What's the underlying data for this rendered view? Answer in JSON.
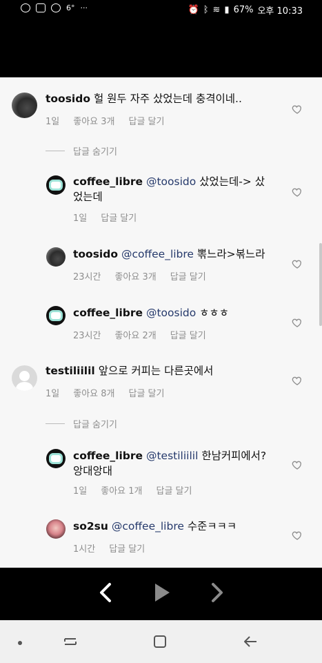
{
  "status_bar": {
    "left_icons": [
      "talk-icon",
      "image-icon",
      "message-icon",
      "camera-icon",
      "more-icon"
    ],
    "temperature": "6°",
    "more": "···",
    "battery": "67%",
    "time": "오후 10:33"
  },
  "comments": [
    {
      "username": "toosido",
      "text": "헐 원두 자주 샀었는데 충격이네..",
      "time": "1일",
      "likes": "좋아요 3개",
      "reply": "답글 달기"
    },
    {
      "hide_replies": "답글 숨기기",
      "username": "coffee_libre",
      "mention": "@toosido",
      "text_line1": "샀었는데-> 샀",
      "text_line2": "었는데",
      "time": "1일",
      "reply": "답글 달기"
    },
    {
      "username": "toosido",
      "mention": "@coffee_libre",
      "text": "뽂느라>볶느라",
      "time": "23시간",
      "likes": "좋아요 3개",
      "reply": "답글 달기"
    },
    {
      "username": "coffee_libre",
      "mention": "@toosido",
      "text": "ㅎㅎㅎ",
      "time": "23시간",
      "likes": "좋아요 2개",
      "reply": "답글 달기"
    },
    {
      "username": "testiliilil",
      "text": "앞으로 커피는 다른곳에서",
      "time": "1일",
      "likes": "좋아요 8개",
      "reply": "답글 달기"
    },
    {
      "hide_replies": "답글 숨기기",
      "username": "coffee_libre",
      "mention": "@testiliilil",
      "text_line1": "한남커피에서?",
      "text_line2": "앙대앙대",
      "time": "1일",
      "likes": "좋아요 1개",
      "reply": "답글 달기"
    },
    {
      "username": "so2su",
      "mention": "@coffee_libre",
      "text": "수준ㅋㅋㅋ",
      "time": "1시간",
      "reply": "답글 달기"
    }
  ],
  "colors": {
    "background": "#f7f7f7",
    "username": "#111111",
    "mention": "#25396b",
    "meta": "#8e8e8e",
    "black_bar": "#000000"
  }
}
